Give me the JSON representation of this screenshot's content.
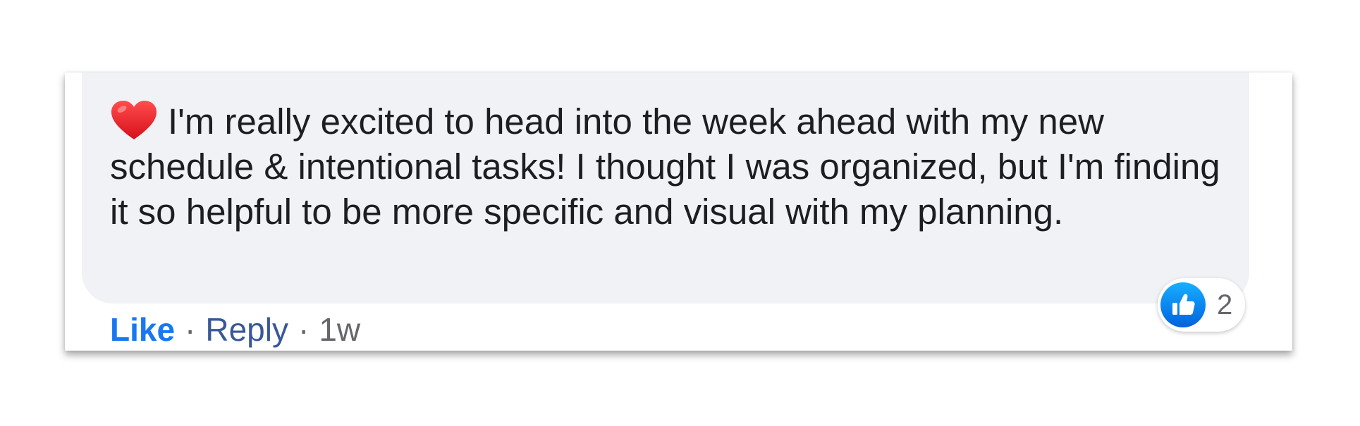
{
  "comment": {
    "emoji_icon": "red-heart-icon",
    "text": "I'm really excited to head into the week ahead with my new schedule & intentional tasks! I thought I was organized, but I'm finding it so helpful to be more specific and visual with my planning."
  },
  "actions": {
    "like_label": "Like",
    "separator": "·",
    "reply_label": "Reply",
    "timestamp": "1w"
  },
  "reactions": {
    "icon": "thumbs-up-icon",
    "count": "2"
  },
  "colors": {
    "bubble_background": "#f0f2f5",
    "like_blue": "#1877f2",
    "reply_blue": "#385898",
    "meta_gray": "#65676b"
  }
}
